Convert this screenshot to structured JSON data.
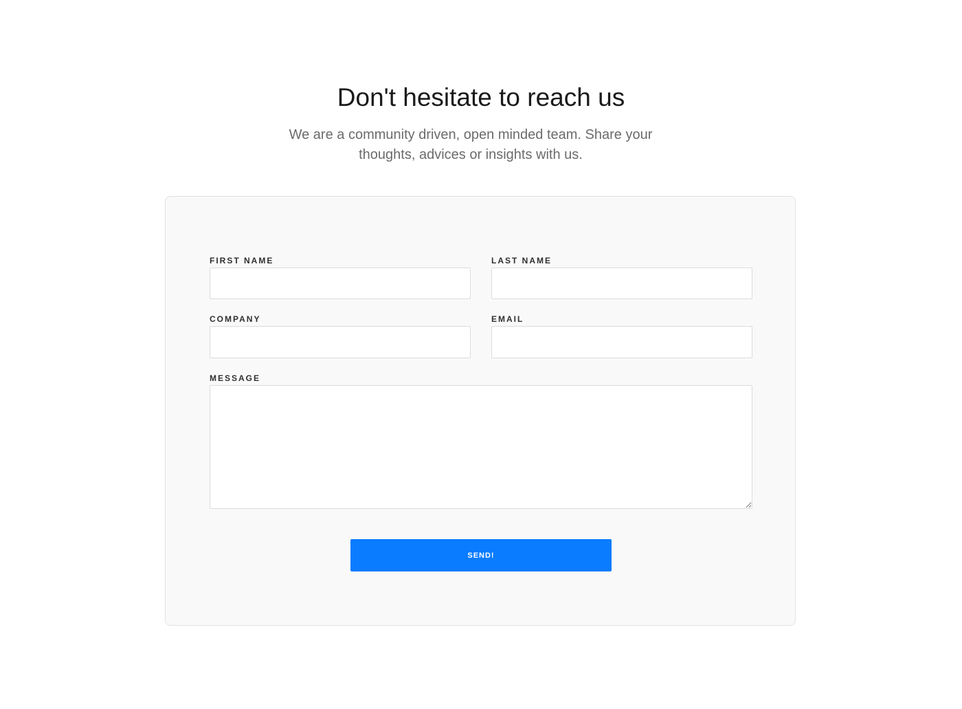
{
  "header": {
    "title": "Don't hesitate to reach us",
    "subtitle": "We are a community driven, open minded team. Share your thoughts, advices or insights with us."
  },
  "form": {
    "first_name": {
      "label": "FIRST NAME",
      "value": "",
      "placeholder": ""
    },
    "last_name": {
      "label": "LAST NAME",
      "value": "",
      "placeholder": ""
    },
    "company": {
      "label": "COMPANY",
      "value": "",
      "placeholder": ""
    },
    "email": {
      "label": "EMAIL",
      "value": "",
      "placeholder": ""
    },
    "message": {
      "label": "MESSAGE",
      "value": "",
      "placeholder": ""
    },
    "submit_label": "SEND!"
  },
  "colors": {
    "accent": "#0a7cff",
    "card_background": "#f9f9f9",
    "heading_text": "#1a1a1a",
    "subtitle_text": "#6b6b6b"
  }
}
